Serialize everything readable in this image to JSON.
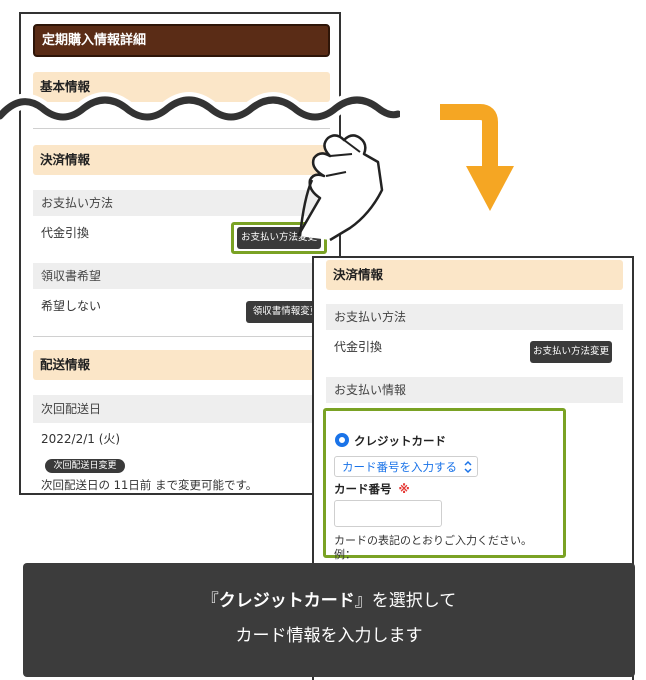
{
  "screen1": {
    "title": "定期購入情報詳細",
    "basic_header": "基本情報",
    "payment_header": "決済情報",
    "payment_method_label": "お支払い方法",
    "payment_method_value": "代金引換",
    "change_payment_button": "お支払い方法変更",
    "receipt_label": "領収書希望",
    "receipt_value": "希望しない",
    "change_receipt_button": "領収書情報変更",
    "shipping_header": "配送情報",
    "next_date_label": "次回配送日",
    "next_date_value": "2022/2/1 (火)",
    "change_date_button": "次回配送日変更",
    "change_note": "次回配送日の 11日前 まで変更可能です。"
  },
  "screen2": {
    "payment_header": "決済情報",
    "payment_method_label": "お支払い方法",
    "payment_method_value": "代金引換",
    "change_payment_button": "お支払い方法変更",
    "payment_info_label": "お支払い情報",
    "credit_card_option": "クレジットカード",
    "card_select_value": "カード番号を入力する",
    "card_number_label": "カード番号",
    "required_mark": "※",
    "card_hint": "カードの表記のとおりご入力ください。",
    "example_label": "例："
  },
  "banner": {
    "quote_open": "『",
    "emphasis": "クレジットカード",
    "quote_close": "』",
    "line1_rest": "を選択して",
    "line2": "カード情報を入力します"
  },
  "colors": {
    "title_bg": "#5a2c16",
    "section_bg": "#fbe6c8",
    "highlight": "#7aa224",
    "arrow": "#f5a623",
    "banner_bg": "#3c3c3c",
    "link_blue": "#1a73e8",
    "required_red": "#e53935"
  },
  "icons": {
    "pointer": "pointing-hand-icon",
    "arrow": "turn-down-arrow-icon",
    "wave": "cut-wave-icon",
    "radio": "radio-selected-icon",
    "select": "select-chevron-icon"
  }
}
